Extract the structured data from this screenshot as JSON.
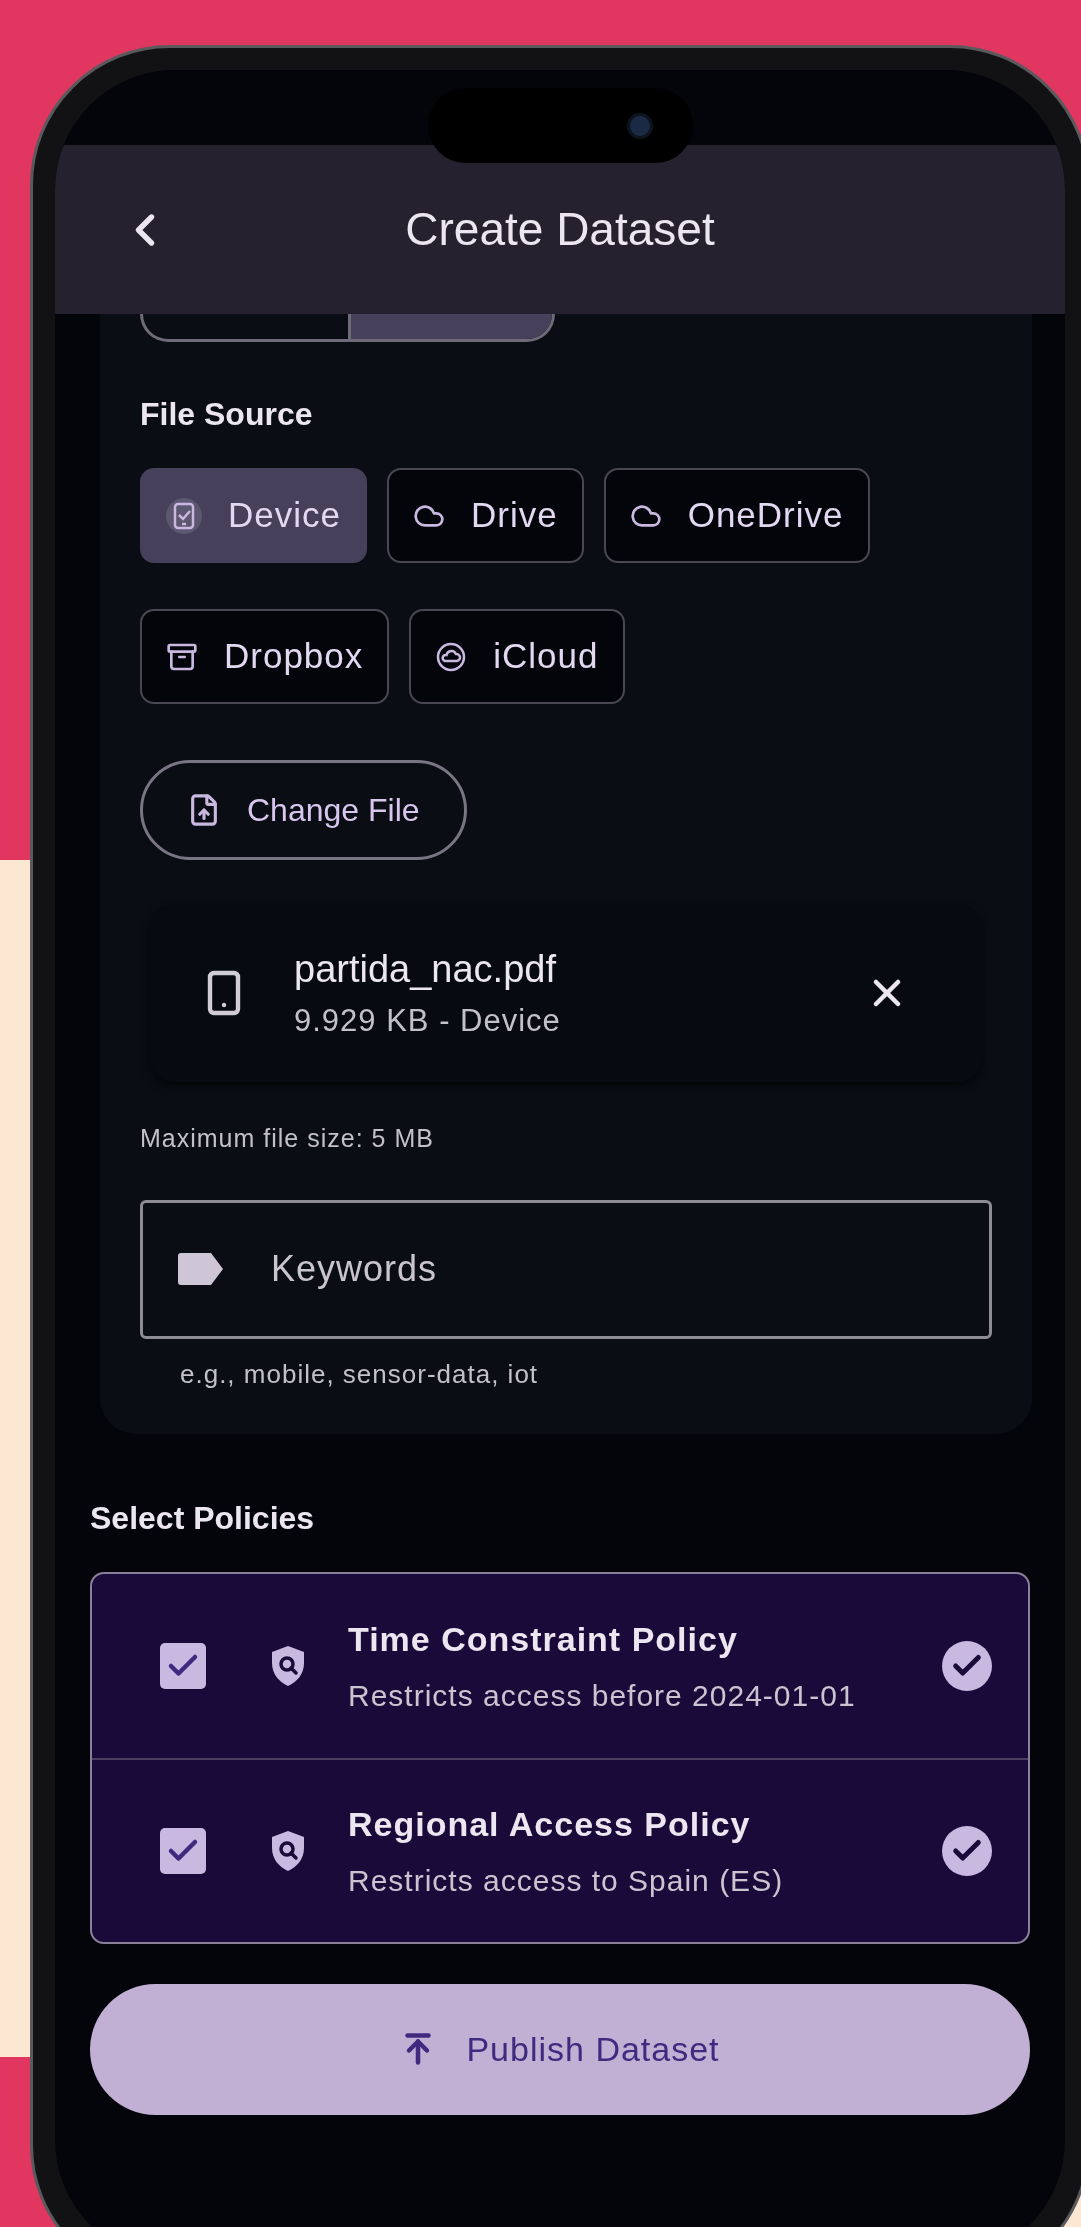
{
  "header": {
    "title": "Create Dataset"
  },
  "file_source": {
    "label": "File Source",
    "sources": [
      {
        "label": "Device",
        "kind": "device",
        "selected": true
      },
      {
        "label": "Drive",
        "kind": "cloud",
        "selected": false
      },
      {
        "label": "OneDrive",
        "kind": "cloud",
        "selected": false
      },
      {
        "label": "Dropbox",
        "kind": "archive",
        "selected": false
      },
      {
        "label": "iCloud",
        "kind": "cloud-circle",
        "selected": false
      }
    ]
  },
  "change_file": {
    "label": "Change File"
  },
  "file": {
    "name": "partida_nac.pdf",
    "meta": "9.929 KB - Device"
  },
  "size_note": "Maximum file size: 5 MB",
  "keywords": {
    "placeholder": "Keywords",
    "helper": "e.g., mobile, sensor-data, iot"
  },
  "policies": {
    "heading": "Select Policies",
    "items": [
      {
        "title": "Time Constraint Policy",
        "description": "Restricts access before 2024-01-01",
        "checked": true
      },
      {
        "title": "Regional Access Policy",
        "description": "Restricts access to Spain (ES)",
        "checked": true
      }
    ]
  },
  "publish": {
    "label": "Publish Dataset"
  }
}
